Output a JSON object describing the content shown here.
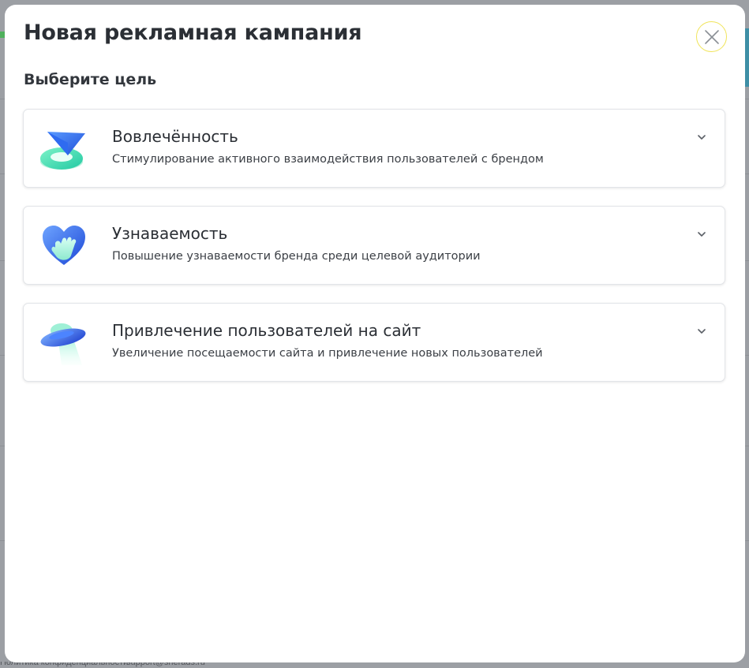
{
  "modal": {
    "title": "Новая рекламная кампания",
    "section_title": "Выберите цель",
    "close_icon": "close-icon"
  },
  "goals": [
    {
      "title": "Вовлечённость",
      "description": "Стимулирование активного взаимодействия пользователей с брендом",
      "icon": "paper-plane-icon"
    },
    {
      "title": "Узнаваемость",
      "description": "Повышение узнаваемости бренда среди целевой аудитории",
      "icon": "heart-hand-icon"
    },
    {
      "title": "Привлечение пользователей на сайт",
      "description": "Увеличение посещаемости сайта и привлечение новых пользователей",
      "icon": "ufo-icon"
    }
  ],
  "background": {
    "footer_privacy": "Политика конфиденциальности",
    "footer_email": "support@sherads.ru"
  },
  "colors": {
    "overlay": "#9c9fa4",
    "title_text": "#2b2f35",
    "card_border": "#e2e4e8",
    "close_ring": "#f0e45a"
  }
}
